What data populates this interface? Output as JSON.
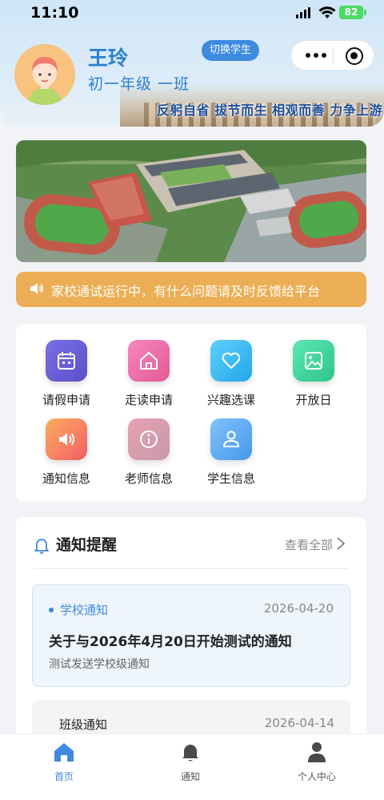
{
  "status_bar": {
    "time": "11:10",
    "battery": "82"
  },
  "header": {
    "student_name": "王玲",
    "class_name": "初一年级 一班",
    "switch_label": "切换学生",
    "slogan": "反躬自省 拔节而生 相观而善 力争上游"
  },
  "notice_bar": {
    "text": "家校通试运行中，有什么问题请及时反馈给平台"
  },
  "quick_menu": [
    {
      "label": "请假申请",
      "icon": "calendar-icon",
      "color": "#6b5fd6"
    },
    {
      "label": "走读申请",
      "icon": "home-icon",
      "color": "#ef6fa8"
    },
    {
      "label": "兴趣选课",
      "icon": "heart-icon",
      "color": "#38b8f2"
    },
    {
      "label": "开放日",
      "icon": "image-icon",
      "color": "#3fd6a0"
    },
    {
      "label": "通知信息",
      "icon": "speaker-icon",
      "color": "#f7845a"
    },
    {
      "label": "老师信息",
      "icon": "info-icon",
      "color": "#d88aa8"
    },
    {
      "label": "学生信息",
      "icon": "user-icon",
      "color": "#5aa8f0"
    }
  ],
  "notifications": {
    "title": "通知提醒",
    "view_all": "查看全部",
    "items": [
      {
        "category": "学校通知",
        "date": "2026-04-20",
        "title": "关于与2026年4月20日开始测试的通知",
        "desc": "测试发送学校级通知"
      },
      {
        "category": "班级通知",
        "date": "2026-04-14"
      }
    ]
  },
  "tabbar": [
    {
      "label": "首页",
      "icon": "home-icon",
      "active": true
    },
    {
      "label": "通知",
      "icon": "bell-icon",
      "active": false
    },
    {
      "label": "个人中心",
      "icon": "person-icon",
      "active": false
    }
  ],
  "colors": {
    "accent": "#3d8be0",
    "notice": "#ecae54"
  }
}
